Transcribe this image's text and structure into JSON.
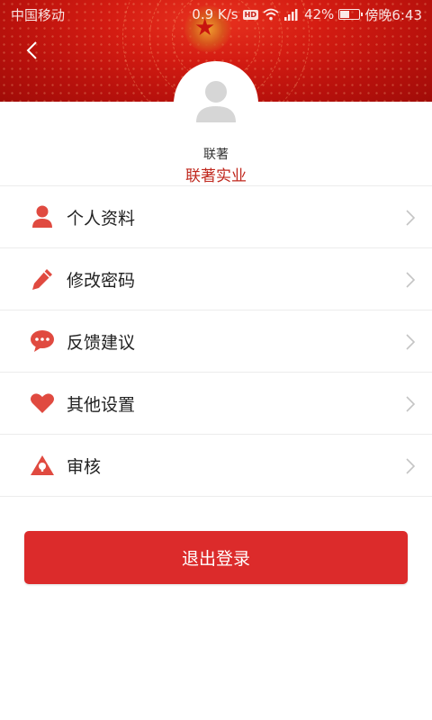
{
  "status_bar": {
    "carrier": "中国移动",
    "speed": "0.9 K/s",
    "hd": "HD",
    "battery_percent": "42%",
    "battery_level": 0.42,
    "time": "傍晚6:43"
  },
  "header": {
    "back_icon": "chevron-left-icon"
  },
  "profile": {
    "avatar_icon": "user-placeholder-icon",
    "name": "联著",
    "company": "联著实业"
  },
  "menu": {
    "items": [
      {
        "label": "个人资料",
        "icon": "person-icon"
      },
      {
        "label": "修改密码",
        "icon": "pencil-icon"
      },
      {
        "label": "反馈建议",
        "icon": "chat-bubble-icon"
      },
      {
        "label": "其他设置",
        "icon": "heart-icon"
      },
      {
        "label": "审核",
        "icon": "warning-triangle-icon"
      }
    ]
  },
  "logout": {
    "label": "退出登录"
  },
  "colors": {
    "accent": "#dc2b2b",
    "icon": "#e04a40",
    "company_text": "#c0281e"
  }
}
